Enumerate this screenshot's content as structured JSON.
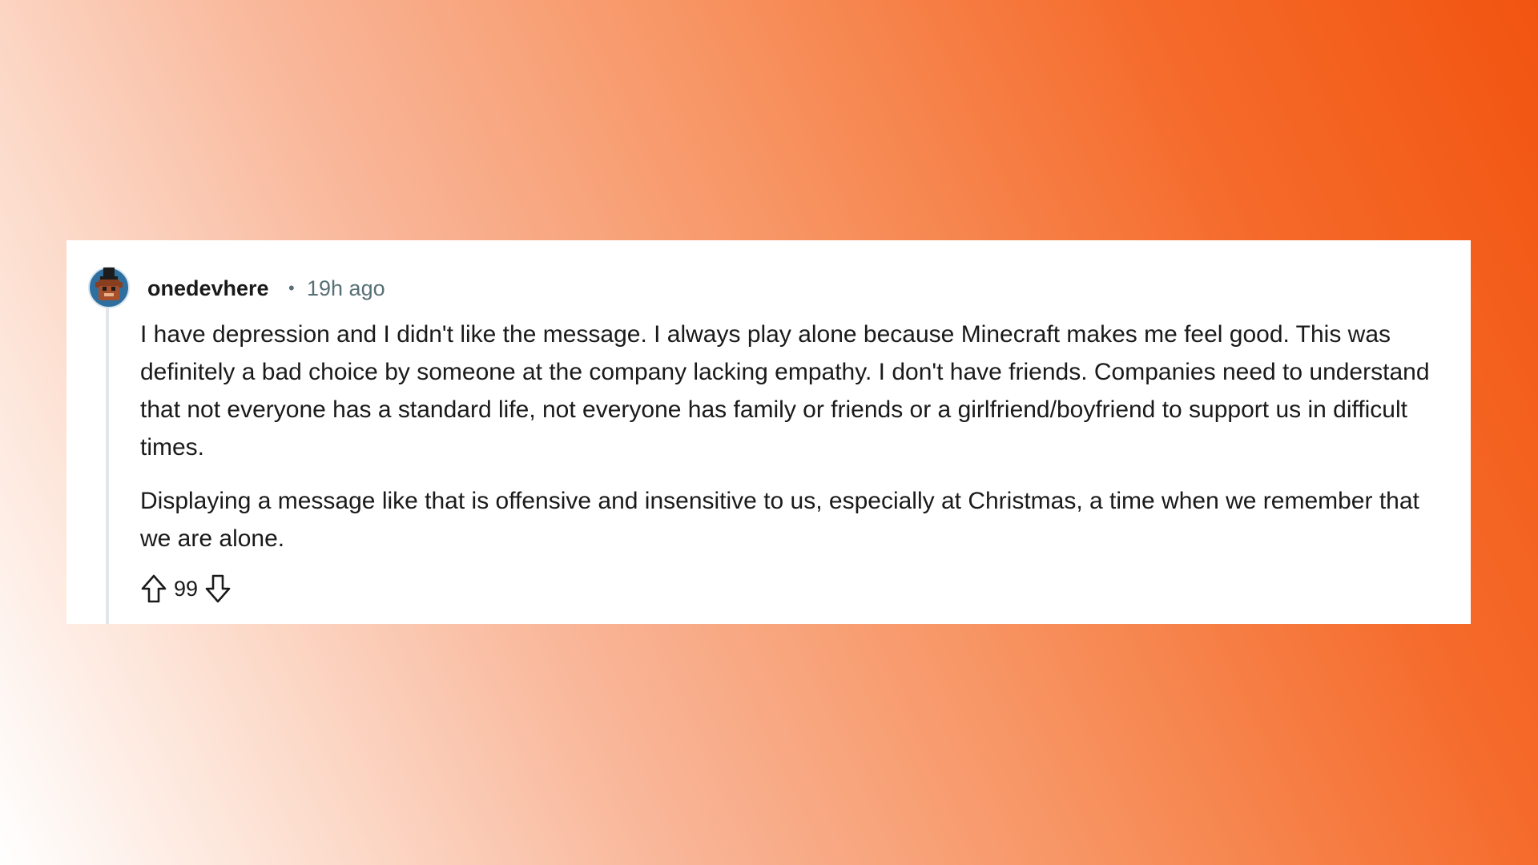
{
  "comment": {
    "username": "onedevhere",
    "separator": "•",
    "timestamp": "19h ago",
    "paragraphs": [
      "I have depression and I didn't like the message. I always play alone because Minecraft makes me feel good. This was definitely a bad choice by someone at the company lacking empathy. I don't have friends. Companies need to understand that not everyone has a standard life, not everyone has family or friends or a girlfriend/boyfriend to support us in difficult times.",
      "Displaying a message like that is offensive and insensitive to us, especially at Christmas, a time when we remember that we are alone."
    ],
    "vote_count": "99",
    "icons": {
      "avatar": "avatar-icon",
      "upvote": "upvote-arrow-icon",
      "downvote": "downvote-arrow-icon"
    }
  },
  "colors": {
    "background_gradient_start": "#ffffff",
    "background_gradient_end": "#f25410",
    "card_background": "#ffffff",
    "text_primary": "#1a1a1b",
    "text_meta": "#576f76",
    "thread_line": "#e3e6e8"
  }
}
